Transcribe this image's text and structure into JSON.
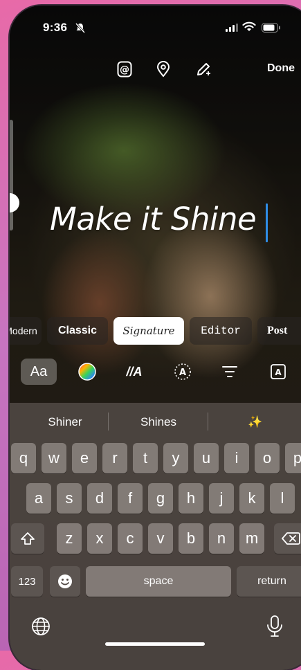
{
  "status_bar": {
    "time": "9:36"
  },
  "toolbar": {
    "done_label": "Done"
  },
  "caption": {
    "text": "Make it Shine"
  },
  "fonts": [
    {
      "label": "Modern"
    },
    {
      "label": "Classic"
    },
    {
      "label": "Signature"
    },
    {
      "label": "Editor"
    },
    {
      "label": "Post"
    }
  ],
  "tools": {
    "text_style_label": "Aa",
    "animate_label": "//A"
  },
  "suggestions": [
    "Shiner",
    "Shines",
    "✨"
  ],
  "keyboard": {
    "row1": [
      "q",
      "w",
      "e",
      "r",
      "t",
      "y",
      "u",
      "i",
      "o",
      "p"
    ],
    "row2": [
      "a",
      "s",
      "d",
      "f",
      "g",
      "h",
      "j",
      "k",
      "l"
    ],
    "row3": [
      "z",
      "x",
      "c",
      "v",
      "b",
      "n",
      "m"
    ],
    "numbers_label": "123",
    "space_label": "space",
    "return_label": "return"
  },
  "colors": {
    "accent_cursor": "#2f8de6",
    "chip_active_bg": "#ffffff"
  }
}
